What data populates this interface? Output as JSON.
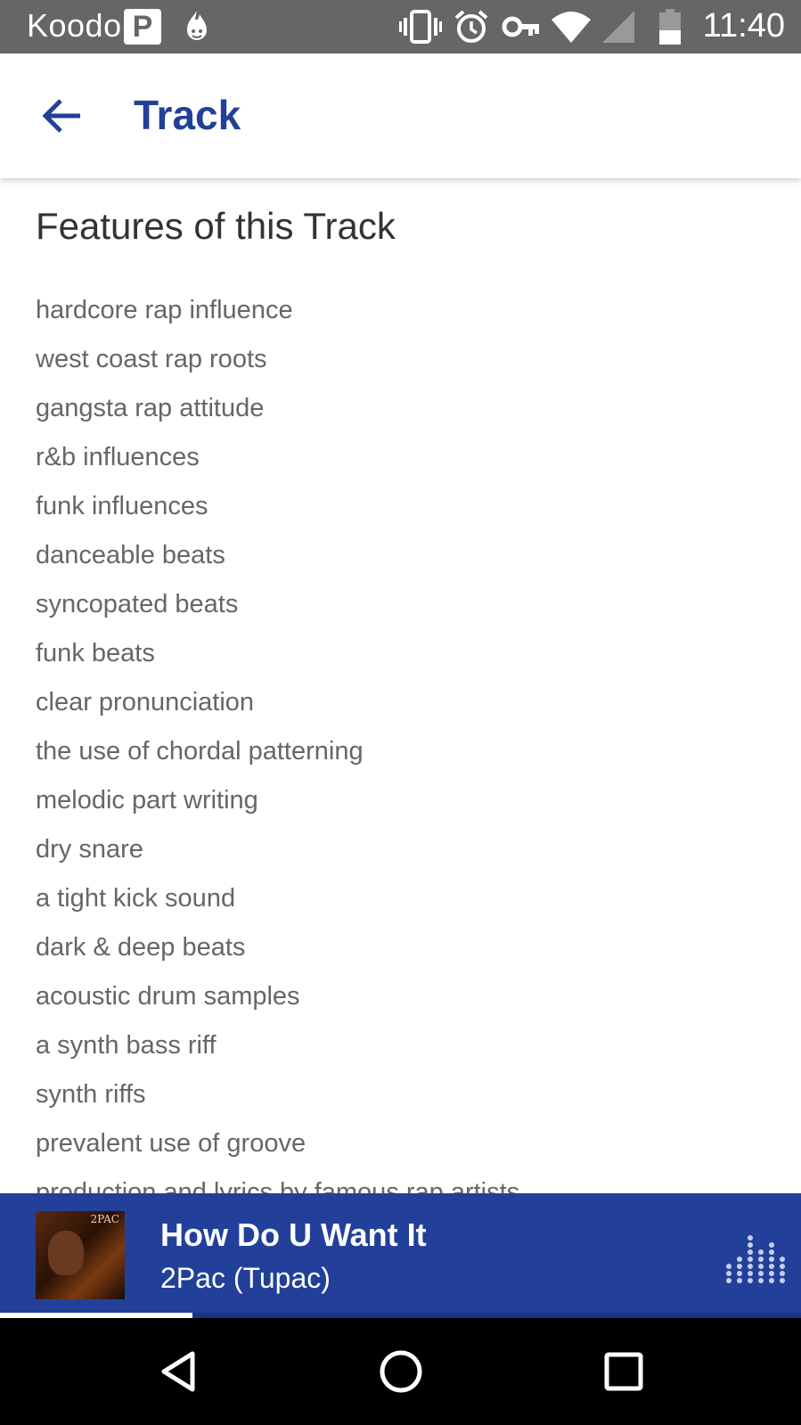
{
  "status_bar": {
    "carrier": "Koodo",
    "parking_label": "P",
    "time": "11:40",
    "icons": [
      "parking-icon",
      "flame-app-icon",
      "vibrate-icon",
      "alarm-icon",
      "vpn-key-icon",
      "wifi-icon",
      "cell-signal-icon",
      "battery-icon"
    ]
  },
  "app_bar": {
    "title": "Track",
    "back_icon": "arrow-left-icon",
    "accent_color": "#22409a"
  },
  "features": {
    "title": "Features of this Track",
    "items": [
      "hardcore rap influence",
      "west coast rap roots",
      "gangsta rap attitude",
      "r&b influences",
      "funk influences",
      "danceable beats",
      "syncopated beats",
      "funk beats",
      "clear pronunciation",
      "the use of chordal patterning",
      "melodic part writing",
      "dry snare",
      "a tight kick sound",
      "dark & deep beats",
      "acoustic drum samples",
      "a synth bass riff",
      "synth riffs",
      "prevalent use of groove",
      "production and lyrics by famous rap artists"
    ]
  },
  "now_playing": {
    "title": "How Do U Want It",
    "artist": "2Pac (Tupac)",
    "album_art_text": "2PAC",
    "progress_fraction": 0.24,
    "background_color": "#22409a"
  },
  "nav_bar": {
    "icons": [
      "back-triangle-icon",
      "home-circle-icon",
      "recents-square-icon"
    ]
  }
}
